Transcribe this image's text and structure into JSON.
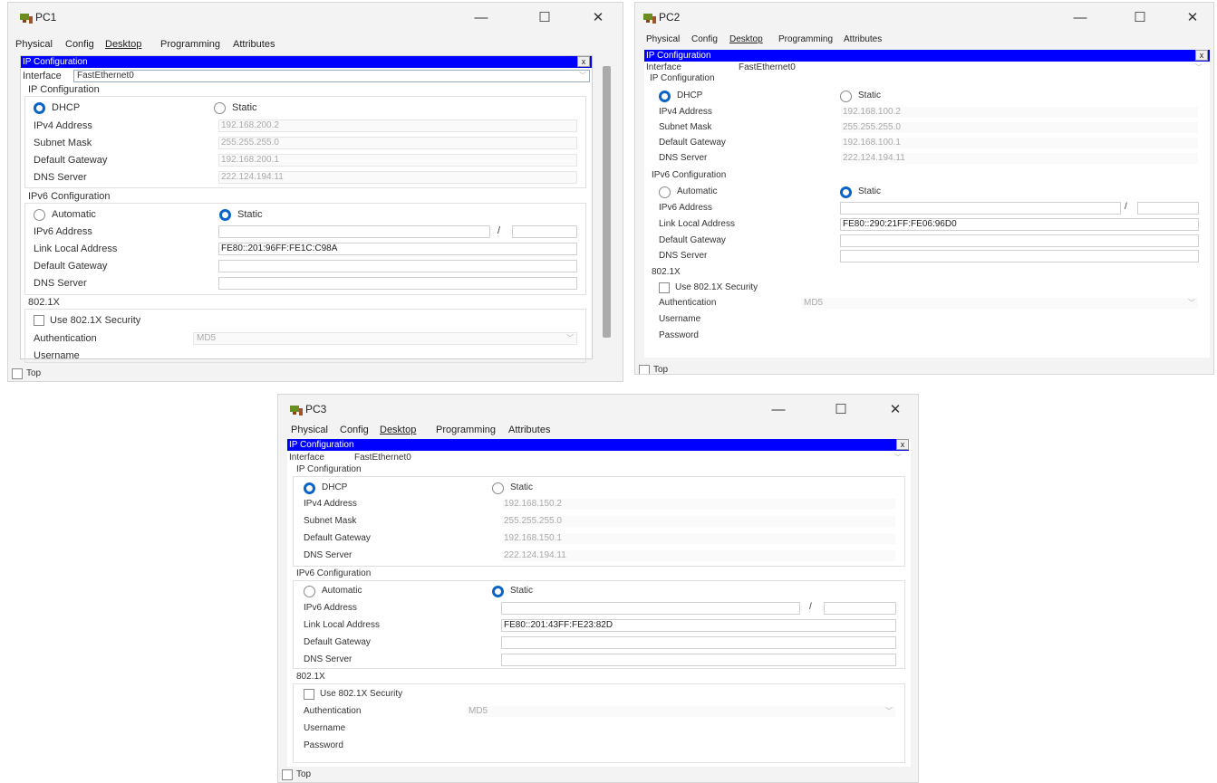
{
  "tabs": [
    "Physical",
    "Config",
    "Desktop",
    "Programming",
    "Attributes"
  ],
  "controls": {
    "minimize": "—",
    "maximize": "☐",
    "close": "✕",
    "panel_close": "x"
  },
  "labels": {
    "ip_configuration_bar": "IP Configuration",
    "interface": "Interface",
    "ip_configuration": "IP Configuration",
    "dhcp": "DHCP",
    "static": "Static",
    "ipv4_address": "IPv4 Address",
    "subnet_mask": "Subnet Mask",
    "default_gateway": "Default Gateway",
    "dns_server": "DNS Server",
    "ipv6_configuration": "IPv6 Configuration",
    "automatic": "Automatic",
    "ipv6_address": "IPv6 Address",
    "link_local_address": "Link Local Address",
    "dot1x": "802.1X",
    "use_dot1x": "Use 802.1X Security",
    "authentication": "Authentication",
    "username": "Username",
    "password": "Password",
    "top": "Top",
    "slash": "/"
  },
  "windows": [
    {
      "title": "PC1",
      "interface": "FastEthernet0",
      "ipv4_address": "192.168.200.2",
      "subnet_mask": "255.255.255.0",
      "default_gateway": "192.168.200.1",
      "dns_server": "222.124.194.11",
      "link_local": "FE80::201:96FF:FE1C:C98A",
      "auth_method": "MD5"
    },
    {
      "title": "PC2",
      "interface": "FastEthernet0",
      "ipv4_address": "192.168.100.2",
      "subnet_mask": "255.255.255.0",
      "default_gateway": "192.168.100.1",
      "dns_server": "222.124.194.11",
      "link_local": "FE80::290:21FF:FE06:96D0",
      "auth_method": "MD5"
    },
    {
      "title": "PC3",
      "interface": "FastEthernet0",
      "ipv4_address": "192.168.150.2",
      "subnet_mask": "255.255.255.0",
      "default_gateway": "192.168.150.1",
      "dns_server": "222.124.194.11",
      "link_local": "FE80::201:43FF:FE23:82D",
      "auth_method": "MD5"
    }
  ]
}
